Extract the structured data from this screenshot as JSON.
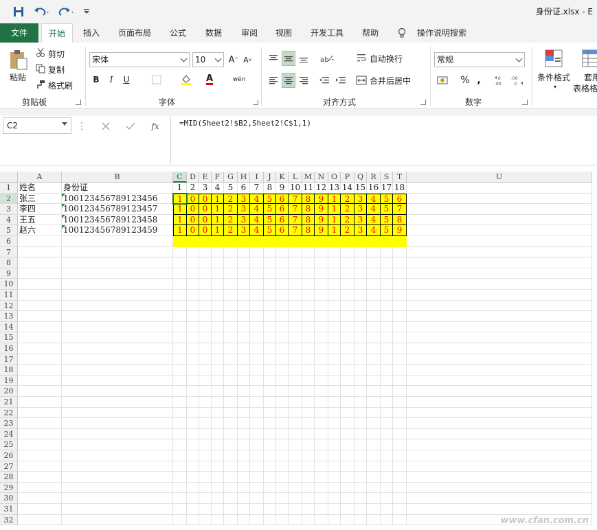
{
  "app": {
    "title": "身份证.xlsx  -  E"
  },
  "ribbon_tabs": [
    "文件",
    "开始",
    "插入",
    "页面布局",
    "公式",
    "数据",
    "审阅",
    "视图",
    "开发工具",
    "帮助",
    "操作说明搜索"
  ],
  "clipboard": {
    "paste": "粘贴",
    "cut": "剪切",
    "copy": "复制",
    "format_painter": "格式刷",
    "label": "剪贴板"
  },
  "font": {
    "name": "宋体",
    "size": "10",
    "bold": "B",
    "italic": "I",
    "underline": "U",
    "label": "字体",
    "fill_glyph": "A",
    "wen": "wén"
  },
  "alignment": {
    "wrap": "自动换行",
    "merge": "合并后居中",
    "label": "对齐方式"
  },
  "number": {
    "format": "常规",
    "label": "数字",
    "percent": "%",
    "comma": ","
  },
  "styles": {
    "conditional": "条件格式",
    "table1": "套用",
    "table2": "表格格"
  },
  "formula_bar": {
    "name_box": "C2",
    "formula": "=MID(Sheet2!$B2,Sheet2!C$1,1)",
    "fx": "fx"
  },
  "sheet": {
    "column_headers": [
      "A",
      "B",
      "C",
      "D",
      "E",
      "F",
      "G",
      "H",
      "I",
      "J",
      "K",
      "L",
      "M",
      "N",
      "O",
      "P",
      "Q",
      "R",
      "S",
      "T",
      "U"
    ],
    "row_numbers": [
      "1",
      "2",
      "3",
      "4",
      "5",
      "6",
      "7",
      "8",
      "9",
      "10",
      "11",
      "12",
      "13",
      "14",
      "15",
      "16",
      "17",
      "18",
      "19",
      "20",
      "21",
      "22",
      "23",
      "24",
      "25",
      "26",
      "27",
      "28",
      "29",
      "30",
      "31",
      "32"
    ],
    "header_row": {
      "a": "姓名",
      "b": "身份证",
      "digits": [
        "1",
        "2",
        "3",
        "4",
        "5",
        "6",
        "7",
        "8",
        "9",
        "10",
        "11",
        "12",
        "13",
        "14",
        "15",
        "16",
        "17",
        "18"
      ]
    },
    "data_rows": [
      {
        "name": "张三",
        "id": "100123456789123456",
        "digits": [
          "1",
          "0",
          "0",
          "1",
          "2",
          "3",
          "4",
          "5",
          "6",
          "7",
          "8",
          "9",
          "1",
          "2",
          "3",
          "4",
          "5",
          "6"
        ]
      },
      {
        "name": "李四",
        "id": "100123456789123457",
        "digits": [
          "1",
          "0",
          "0",
          "1",
          "2",
          "3",
          "4",
          "5",
          "6",
          "7",
          "8",
          "9",
          "1",
          "2",
          "3",
          "4",
          "5",
          "7"
        ]
      },
      {
        "name": "王五",
        "id": "100123456789123458",
        "digits": [
          "1",
          "0",
          "0",
          "1",
          "2",
          "3",
          "4",
          "5",
          "6",
          "7",
          "8",
          "9",
          "1",
          "2",
          "3",
          "4",
          "5",
          "8"
        ]
      },
      {
        "name": "赵六",
        "id": "100123456789123459",
        "digits": [
          "1",
          "0",
          "0",
          "1",
          "2",
          "3",
          "4",
          "5",
          "6",
          "7",
          "8",
          "9",
          "1",
          "2",
          "3",
          "4",
          "5",
          "9"
        ]
      }
    ],
    "active_cell": "C2"
  },
  "colors": {
    "accent": "#217346",
    "highlight": "#ffff00",
    "digit_text": "#ff0000",
    "watermark": "#c8c8c8"
  },
  "watermark": "www.cfan.com.cn"
}
